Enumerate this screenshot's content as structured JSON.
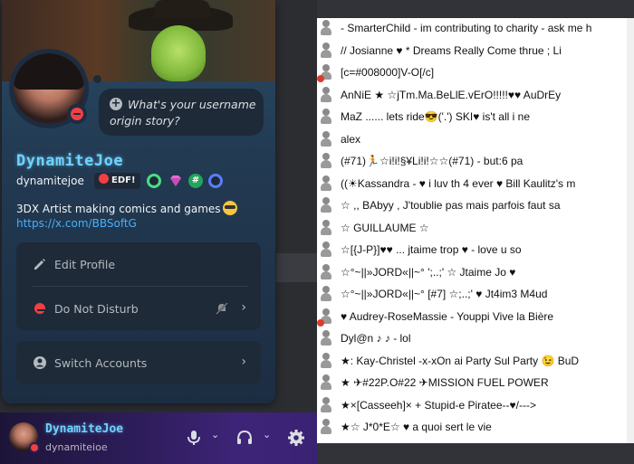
{
  "profile": {
    "status_prompt": "What's your username origin story?",
    "display_name": "DynamiteJoe",
    "username": "dynamitejoe",
    "tag_pill": "EDF!",
    "badge_hashtag": "#",
    "bio": "3DX Artist making comics and games",
    "link": "https://x.com/BBSoftG",
    "menu": {
      "edit_profile": "Edit Profile",
      "do_not_disturb": "Do Not Disturb",
      "switch_accounts": "Switch Accounts"
    }
  },
  "user_bar": {
    "display_name": "DynamiteJoe",
    "handle": "dynamiteioe"
  },
  "chat_list": [
    {
      "text": "- SmarterChild - im contributing to charity - ask me h"
    },
    {
      "text": "// Josianne ♥ * Dreams Really Come thrue ; Li"
    },
    {
      "text": "[c=#008000]V-O[/c]"
    },
    {
      "text": "AnNiE ★ ☆jTm.Ma.BeLlE.vErO!!!!!♥♥ AuDrEy"
    },
    {
      "text": "MaZ ...... lets ride😎('.') SKI♥      is't all i ne"
    },
    {
      "text": "alex"
    },
    {
      "text": "(#71)🏃☆i!i!§¥Li!i!☆☆(#71) - but:6 pa"
    },
    {
      "text": "((☀Kassandra - ♥ i luv th 4 ever ♥ Bill Kaulitz's m"
    },
    {
      "text": "☆ ,, BAbyy , J'toublie pas mais parfois faut sa"
    },
    {
      "text": "☆ GUILLAUME ☆"
    },
    {
      "text": "☆[{J-P}]♥♥ ... jtaime trop ♥ - love u so"
    },
    {
      "text": "☆°~||»JORD«||~° ';..;' ☆ Jtaime Jo ♥"
    },
    {
      "text": "☆°~||»JORD«||~° [#7] ☆;..;' ♥ Jt4im3 M4ud"
    },
    {
      "text": "♥ Audrey-RoseMassie - Youppi Vive la Bière"
    },
    {
      "text": "Dyl@n ♪ ♪ - lol"
    },
    {
      "text": "★: Kay-Christel -x-xOn ai Party Sul Party 😉 BuD"
    },
    {
      "text": "★ ✈#22P.O#22 ✈MISSION FUEL POWER"
    },
    {
      "text": "★×[Casseeh]× + Stupid-e Piratee--♥/--->"
    },
    {
      "text": "★☆ J*0*E☆ ♥ a quoi sert le vie"
    }
  ],
  "colors": {
    "accent_name": "#6fd3ff",
    "dnd_red": "#f23f43",
    "link_blue": "#46b0ff",
    "panel_bg": "#1e2a38"
  },
  "icons": {
    "edit": "pencil-icon",
    "dnd": "dnd-status-icon",
    "switch": "user-circle-icon",
    "mic": "microphone-icon",
    "headset": "headphones-icon",
    "settings": "gear-icon"
  }
}
